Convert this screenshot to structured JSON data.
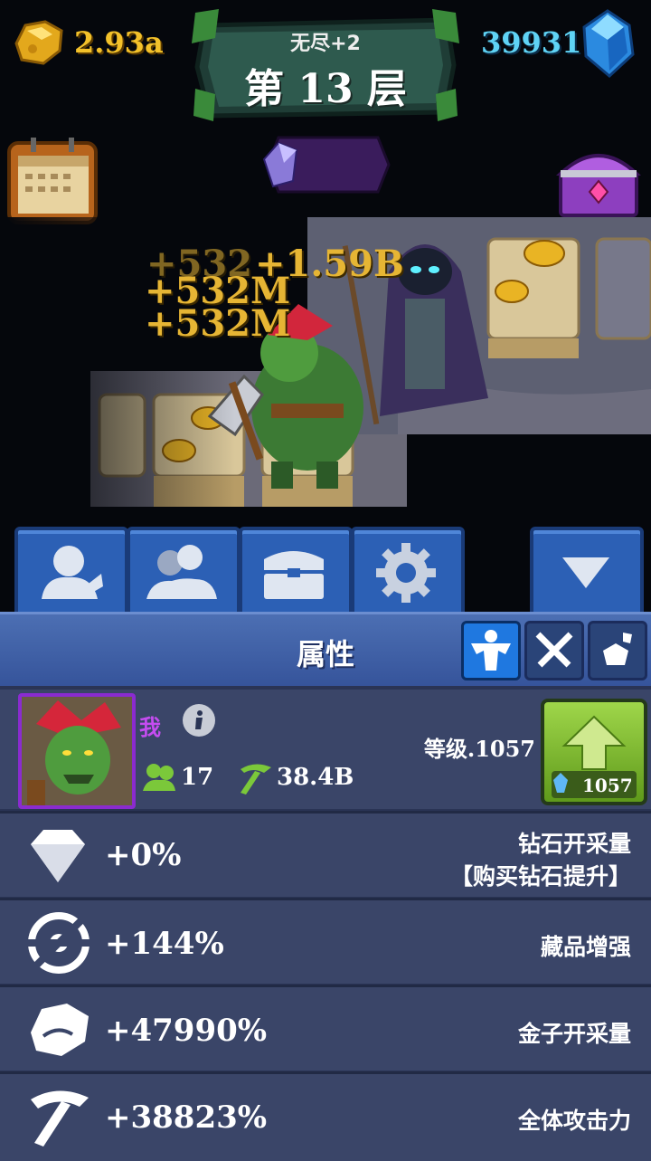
{
  "top": {
    "gold_amount": "2.93a",
    "gem_amount": "39931",
    "mode_label": "无尽+2",
    "floor_label": "第 13 层"
  },
  "scene": {
    "floating_numbers": [
      "+532",
      "+532M",
      "+532M",
      "+1.59B"
    ]
  },
  "tabs": [
    {
      "name": "hero-tab",
      "icon": "person-icon"
    },
    {
      "name": "party-tab",
      "icon": "group-icon"
    },
    {
      "name": "chest-tab",
      "icon": "chest-icon"
    },
    {
      "name": "settings-tab",
      "icon": "gear-icon"
    },
    {
      "name": "collapse-tab",
      "icon": "triangle-down-icon"
    }
  ],
  "panel": {
    "title": "属性",
    "subtabs": [
      "strength-icon",
      "swords-icon",
      "rocks-icon"
    ]
  },
  "hero": {
    "name": "我",
    "allies": "17",
    "mining": "38.4B",
    "level_label": "等级.1057",
    "upgrade_cost": "1057"
  },
  "stats": [
    {
      "icon": "diamond-icon",
      "value": "+0%",
      "label": "钻石开采量",
      "sub_label": "【购买钻石提升】"
    },
    {
      "icon": "target-icon",
      "value": "+144%",
      "label": "藏品增强"
    },
    {
      "icon": "gold-nugget-icon",
      "value": "+47990%",
      "label": "金子开采量"
    },
    {
      "icon": "pickaxe-icon",
      "value": "+38823%",
      "label": "全体攻击力"
    }
  ],
  "colors": {
    "gold_text": "#f3c12a",
    "gem_text": "#5fd3f5",
    "panel_blue": "#35539a",
    "upgrade_green": "#7cc021",
    "hero_name": "#c54cf0"
  }
}
